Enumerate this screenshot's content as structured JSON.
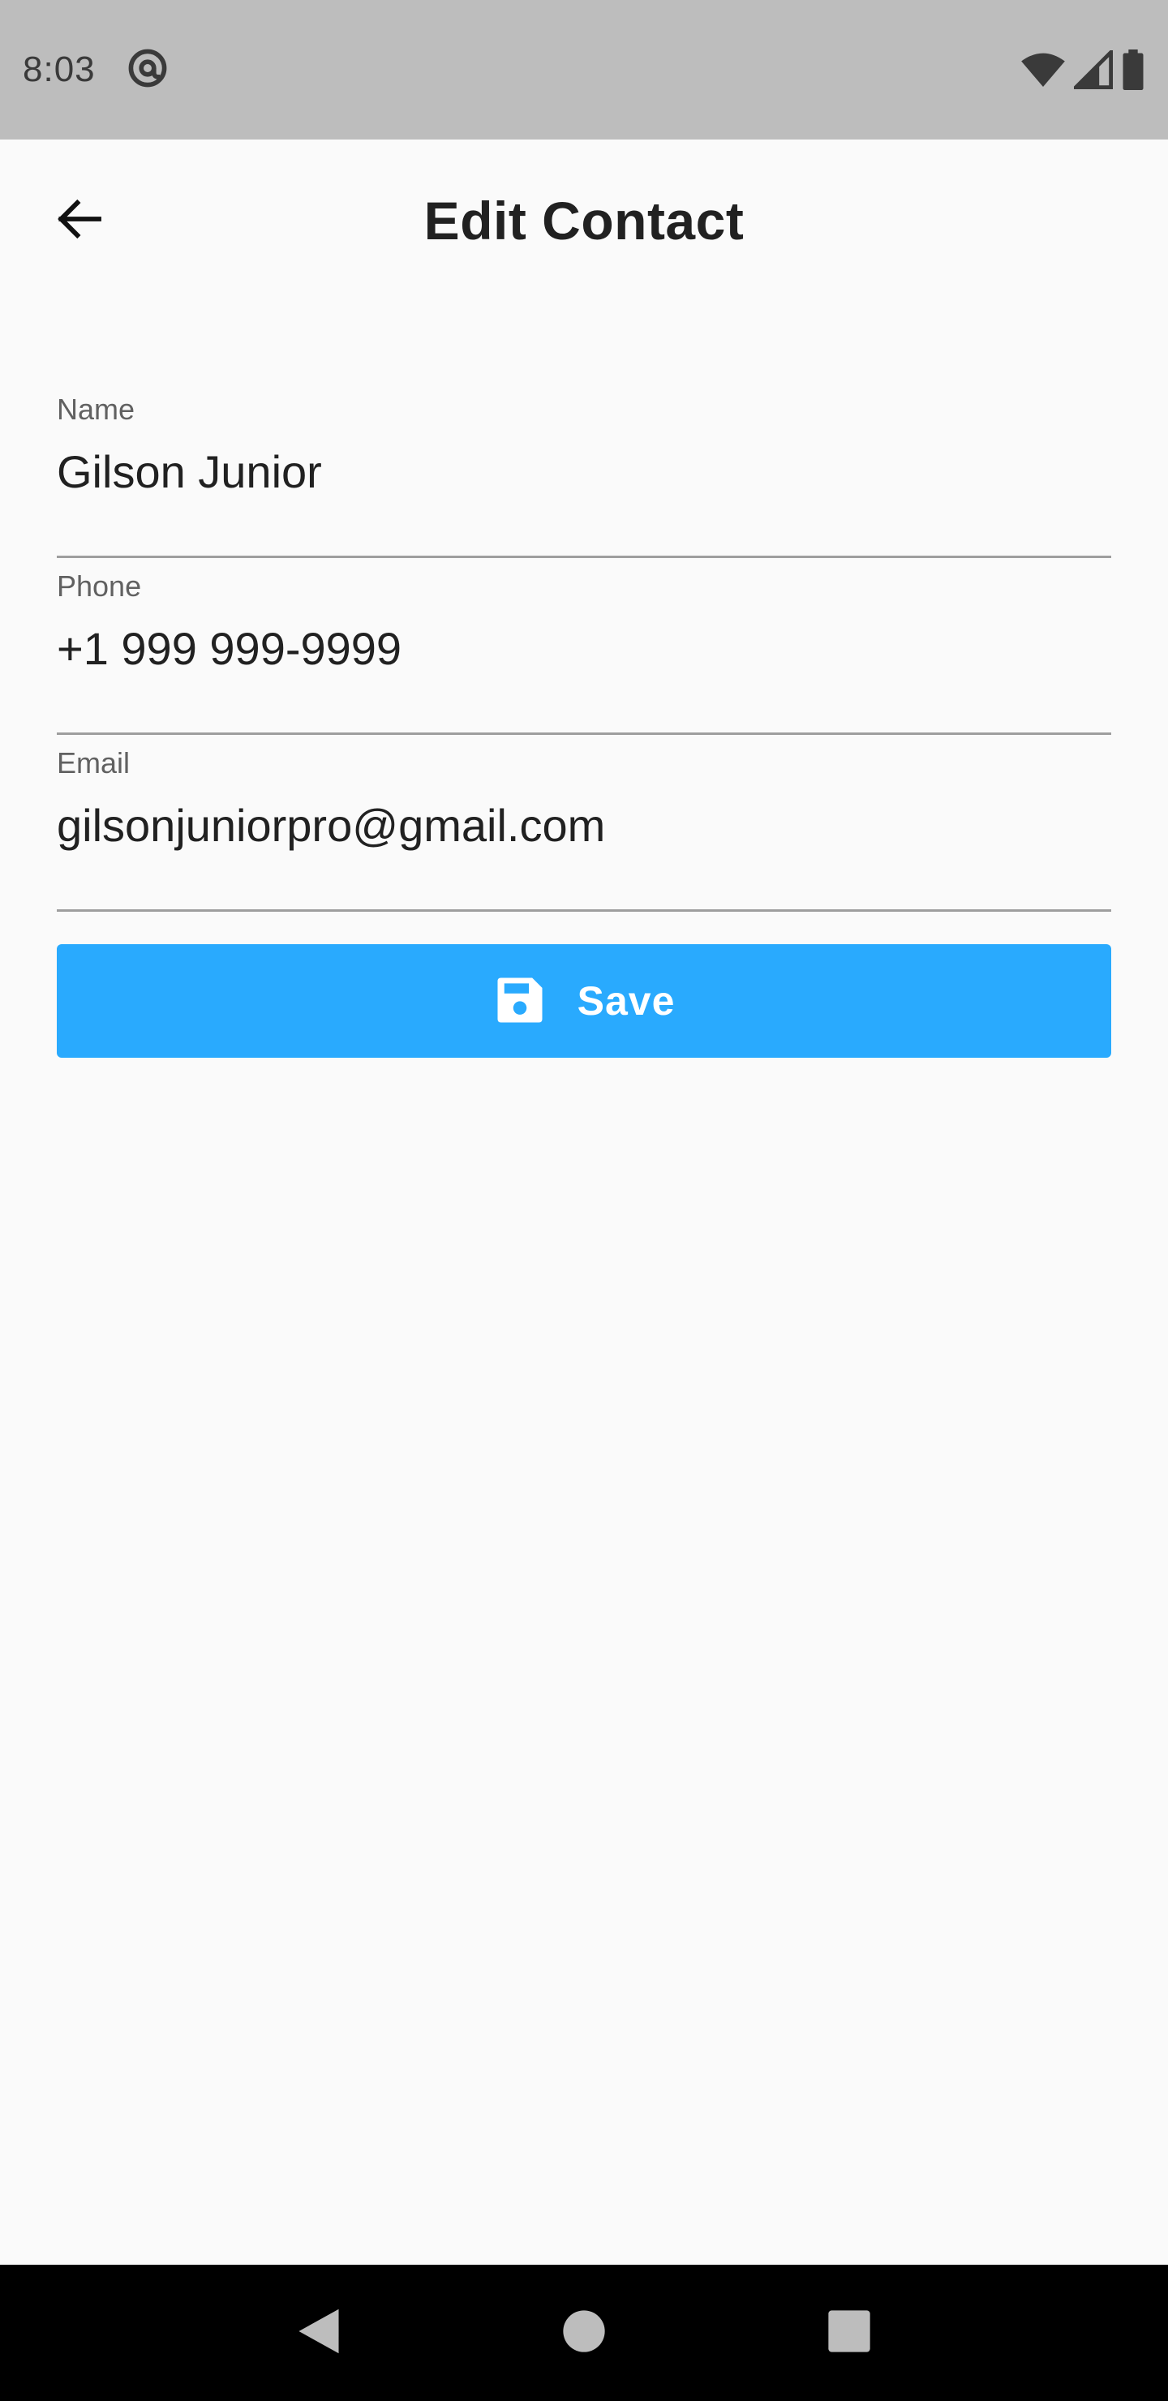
{
  "status_bar": {
    "time": "8:03",
    "icons": [
      "at-sign-icon",
      "wifi-icon",
      "cell-signal-icon",
      "battery-icon"
    ]
  },
  "app_bar": {
    "title": "Edit Contact",
    "back_icon": "arrow-left-icon"
  },
  "form": {
    "fields": [
      {
        "label": "Name",
        "value": "Gilson Junior"
      },
      {
        "label": "Phone",
        "value": "+1 999 999-9999"
      },
      {
        "label": "Email",
        "value": "gilsonjuniorpro@gmail.com"
      }
    ]
  },
  "save_button": {
    "label": "Save",
    "icon": "floppy-disk-icon"
  },
  "nav_bar": {
    "icons": [
      "nav-back-icon",
      "nav-home-icon",
      "nav-recents-icon"
    ]
  },
  "colors": {
    "accent": "#29aafe",
    "status_bar": "#bdbdbd",
    "background": "#fafafa",
    "nav_bar": "#000000"
  }
}
